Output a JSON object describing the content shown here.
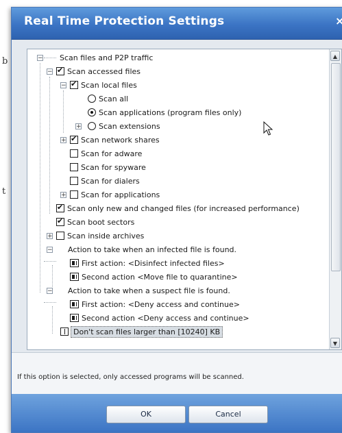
{
  "window": {
    "title": "Real Time Protection Settings",
    "close_glyph": "×"
  },
  "background_text": [
    "b",
    "t"
  ],
  "tree": {
    "items": [
      {
        "label": "Scan files and P2P traffic",
        "control": "none",
        "checked": false,
        "expander": "minus"
      },
      {
        "label": "Scan accessed files",
        "control": "checkbox",
        "checked": true,
        "expander": "minus"
      },
      {
        "label": "Scan local files",
        "control": "checkbox",
        "checked": true,
        "expander": "minus"
      },
      {
        "label": "Scan all",
        "control": "radio",
        "checked": false,
        "expander": "none"
      },
      {
        "label": "Scan applications (program files only)",
        "control": "radio",
        "checked": true,
        "expander": "none"
      },
      {
        "label": "Scan extensions",
        "control": "radio",
        "checked": false,
        "expander": "plus"
      },
      {
        "label": "Scan network shares",
        "control": "checkbox",
        "checked": true,
        "expander": "plus"
      },
      {
        "label": "Scan for adware",
        "control": "checkbox",
        "checked": false,
        "expander": "none"
      },
      {
        "label": "Scan for spyware",
        "control": "checkbox",
        "checked": false,
        "expander": "none"
      },
      {
        "label": "Scan for dialers",
        "control": "checkbox",
        "checked": false,
        "expander": "none"
      },
      {
        "label": "Scan for applications",
        "control": "checkbox",
        "checked": false,
        "expander": "plus"
      },
      {
        "label": "Scan only new and changed files (for increased performance)",
        "control": "checkbox",
        "checked": true,
        "expander": "none"
      },
      {
        "label": "Scan boot sectors",
        "control": "checkbox",
        "checked": true,
        "expander": "none"
      },
      {
        "label": "Scan inside archives",
        "control": "checkbox",
        "checked": false,
        "expander": "plus"
      },
      {
        "label": "Action to take when an infected file is found.",
        "control": "none",
        "checked": false,
        "expander": "minus"
      },
      {
        "label": "First action: <Disinfect infected files>",
        "control": "action",
        "checked": false,
        "expander": "none"
      },
      {
        "label": "Second action <Move file to quarantine>",
        "control": "action",
        "checked": false,
        "expander": "none"
      },
      {
        "label": "Action to take when a suspect file is found.",
        "control": "none",
        "checked": false,
        "expander": "minus"
      },
      {
        "label": "First action: <Deny access and continue>",
        "control": "action",
        "checked": false,
        "expander": "none"
      },
      {
        "label": "Second action <Deny access and continue>",
        "control": "action",
        "checked": false,
        "expander": "none"
      },
      {
        "label": "Don't scan files larger than [10240] KB",
        "control": "field",
        "checked": false,
        "expander": "none",
        "selected": true
      }
    ]
  },
  "scrollbar": {
    "up_glyph": "▲",
    "down_glyph": "▼"
  },
  "description": "If this option is selected, only accessed programs will be scanned.",
  "buttons": {
    "ok": "OK",
    "cancel": "Cancel"
  }
}
